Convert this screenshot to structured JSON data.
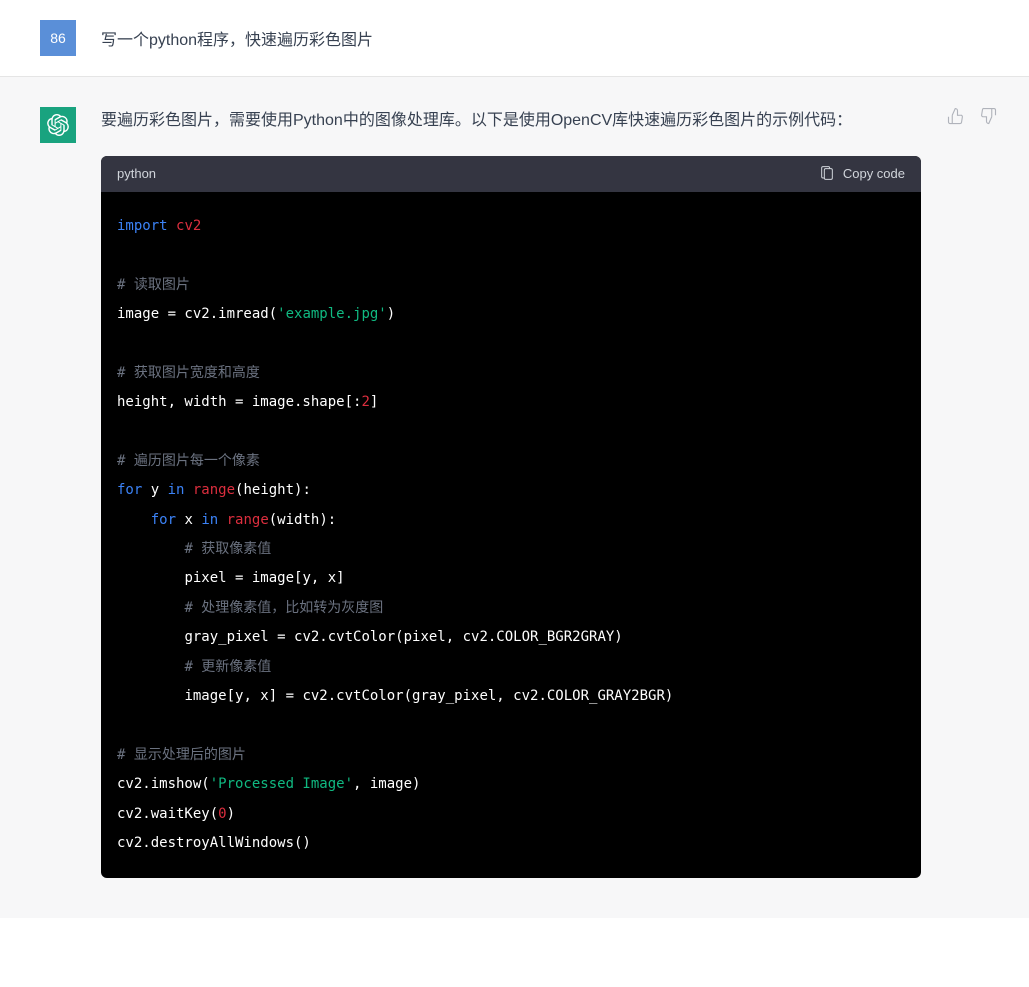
{
  "user": {
    "badge": "86",
    "prompt": "写一个python程序，快速遍历彩色图片"
  },
  "assistant": {
    "intro": "要遍历彩色图片，需要使用Python中的图像处理库。以下是使用OpenCV库快速遍历彩色图片的示例代码：",
    "code": {
      "language": "python",
      "copy_label": "Copy code",
      "lines": {
        "l1_kw": "import",
        "l1_mod": "cv2",
        "l2_cm": "# 读取图片",
        "l3_a": "image = cv2.imread(",
        "l3_str": "'example.jpg'",
        "l3_b": ")",
        "l4_cm": "# 获取图片宽度和高度",
        "l5_a": "height, width = image.shape[:",
        "l5_num": "2",
        "l5_b": "]",
        "l6_cm": "# 遍历图片每一个像素",
        "l7_for": "for",
        "l7_y": " y ",
        "l7_in": "in",
        "l7_range": " range",
        "l7_rest": "(height):",
        "l8_for": "for",
        "l8_x": " x ",
        "l8_in": "in",
        "l8_range": " range",
        "l8_rest": "(width):",
        "l9_cm": "# 获取像素值",
        "l10": "pixel = image[y, x]",
        "l11_cm": "# 处理像素值，比如转为灰度图",
        "l12": "gray_pixel = cv2.cvtColor(pixel, cv2.COLOR_BGR2GRAY)",
        "l13_cm": "# 更新像素值",
        "l14": "image[y, x] = cv2.cvtColor(gray_pixel, cv2.COLOR_GRAY2BGR)",
        "l15_cm": "# 显示处理后的图片",
        "l16_a": "cv2.imshow(",
        "l16_str": "'Processed Image'",
        "l16_b": ", image)",
        "l17_a": "cv2.waitKey(",
        "l17_num": "0",
        "l17_b": ")",
        "l18": "cv2.destroyAllWindows()"
      }
    }
  }
}
